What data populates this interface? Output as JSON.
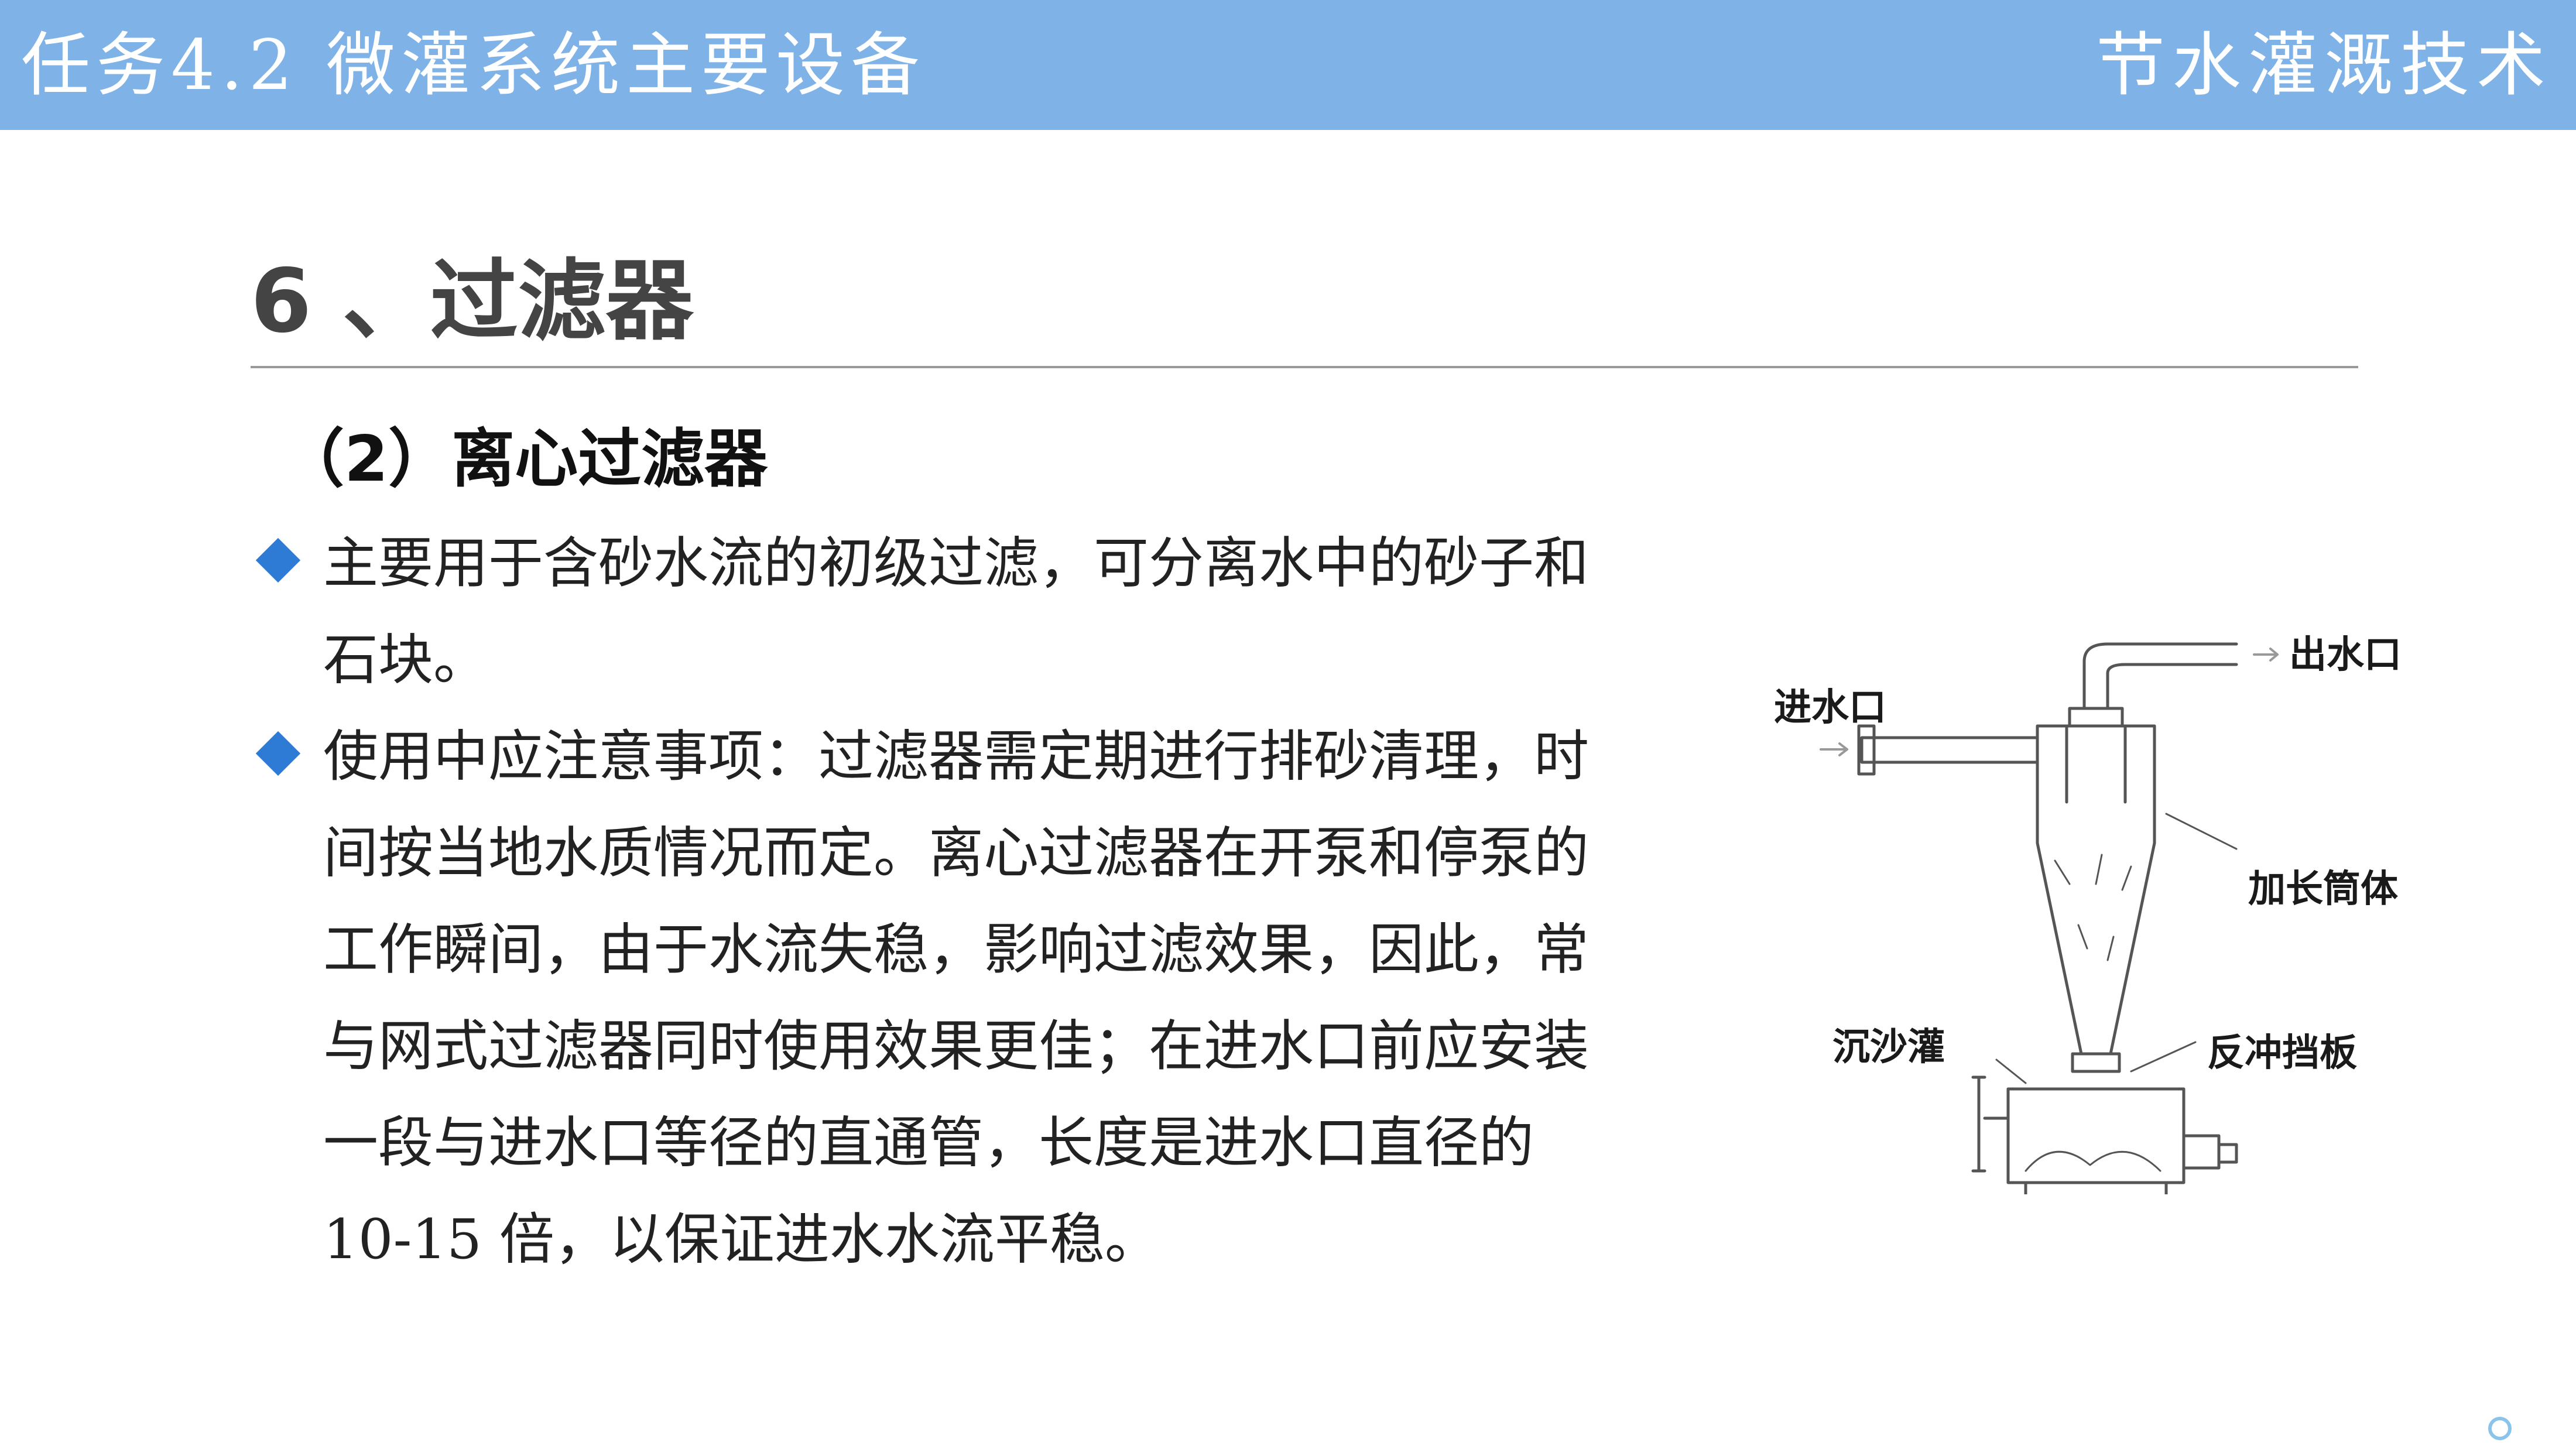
{
  "header": {
    "task_title": "任务4.2  微灌系统主要设备",
    "course_name": "节水灌溉技术"
  },
  "section": {
    "title": "6 、过滤器",
    "subsection_title": "（2）离心过滤器"
  },
  "bullets": [
    {
      "text": "主要用于含砂水流的初级过滤，可分离水中的砂子和石块。"
    },
    {
      "text_before_number": "使用中应注意事项：过滤器需定期进行排砂清理，时间按当地水质情况而定。离心过滤器在开泵和停泵的工作瞬间，由于水流失稳，影响过滤效果，因此，常与网式过滤器同时使用效果更佳；在进水口前应安装一段与进水口等径的直通管，长度是进水口直径的 ",
      "number": "10-15",
      "text_after_number": " 倍，以保证进水水流平稳。"
    }
  ],
  "diagram": {
    "labels": {
      "inlet": "进水口",
      "outlet": "出水口",
      "extended_cylinder": "加长筒体",
      "sand_tank": "沉沙灌",
      "backflush_baffle": "反冲挡板"
    },
    "line_color": "#555555"
  },
  "icons": {
    "bullet_marker": "diamond-bullet-icon",
    "bullet_color": "#2e7bd6",
    "watermark": "watermark-logo-icon"
  },
  "colors": {
    "header_bar": "#7fb2e6",
    "header_text": "#ffffff",
    "title_text": "#444444"
  }
}
